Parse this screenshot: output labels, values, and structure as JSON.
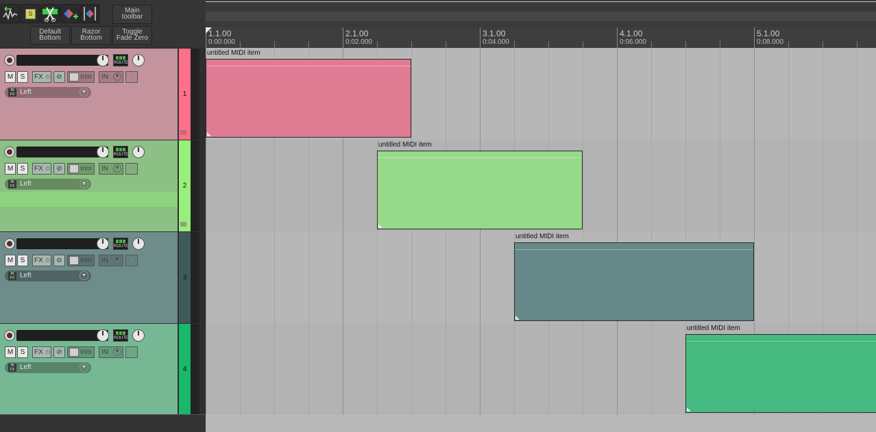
{
  "toolbar": {
    "icons": [
      "undo-waveform-icon",
      "solo-icon",
      "razor-cut-icon",
      "marker-add-icon",
      "time-selection-icon"
    ],
    "buttons": {
      "main_toolbar": "Main\ntoolbar",
      "default_bottom": "Default\nBottom",
      "razor_bottom": "Razor\nBottom",
      "toggle_fade_zero": "Toggle\nFade Zero"
    }
  },
  "ruler": {
    "bars": [
      {
        "bar": "1.1.00",
        "time": "0:00.000"
      },
      {
        "bar": "2.1.00",
        "time": "0:02.000"
      },
      {
        "bar": "3.1.00",
        "time": "0:04.000"
      },
      {
        "bar": "4.1.00",
        "time": "0:06.000"
      },
      {
        "bar": "5.1.00",
        "time": "0:08.000"
      }
    ]
  },
  "tracks": [
    {
      "number": "1",
      "mute": "M",
      "solo": "S",
      "fx": "FX",
      "env": "trim",
      "input": "IN",
      "route": "ROUTE",
      "channel": "Left",
      "channel_tag": "IN FX",
      "color": "#ff6f8a",
      "panel_color": "#c4949e",
      "lane_color": "#b8b8b8",
      "item": {
        "label": "untitled MIDI item",
        "color": "#e07b94",
        "start_bar": 1,
        "length_bars": 1.5
      }
    },
    {
      "number": "2",
      "mute": "M",
      "solo": "S",
      "fx": "FX",
      "env": "trim",
      "input": "IN",
      "route": "ROUTE",
      "channel": "Left",
      "channel_tag": "IN FX",
      "color": "#96f07a",
      "panel_color": "#8cc084",
      "lane_color": "#b1b1b1",
      "item": {
        "label": "untitled MIDI item",
        "color": "#96d98a",
        "start_bar": 2.25,
        "length_bars": 1.5
      }
    },
    {
      "number": "3",
      "mute": "M",
      "solo": "S",
      "fx": "FX",
      "env": "trim",
      "input": "IN",
      "route": "ROUTE",
      "channel": "Left",
      "channel_tag": "IN FX",
      "color": "#3e5a5a",
      "panel_color": "#6e8c8a",
      "lane_color": "#b8b8b8",
      "item": {
        "label": "untitled MIDI item",
        "color": "#668888",
        "start_bar": 3.25,
        "length_bars": 1.75
      }
    },
    {
      "number": "4",
      "mute": "M",
      "solo": "S",
      "fx": "FX",
      "env": "trim",
      "input": "IN",
      "route": "ROUTE",
      "channel": "Left",
      "channel_tag": "IN FX",
      "color": "#19b86a",
      "panel_color": "#76b894",
      "lane_color": "#b1b1b1",
      "item": {
        "label": "untitled MIDI item",
        "color": "#45b97f",
        "start_bar": 4.5,
        "length_bars": 1.5
      }
    }
  ]
}
